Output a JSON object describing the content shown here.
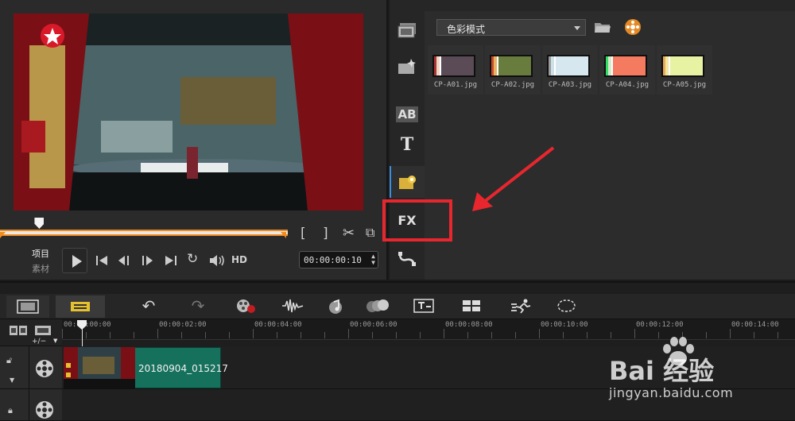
{
  "library": {
    "category_select": "色彩模式",
    "thumbnails": [
      {
        "name": "CP-A01.jpg",
        "colors": [
          "#a33",
          "#f1d6c4",
          "#fff",
          "#5b4b56"
        ]
      },
      {
        "name": "CP-A02.jpg",
        "colors": [
          "#c94a2a",
          "#e8b463",
          "#fff",
          "#687c3e"
        ]
      },
      {
        "name": "CP-A03.jpg",
        "colors": [
          "#9b9b9b",
          "#cfe1e8",
          "#fff",
          "#d7e7ef"
        ]
      },
      {
        "name": "CP-A04.jpg",
        "colors": [
          "#3d6",
          "#d4eac8",
          "#fff",
          "#f47a60"
        ]
      },
      {
        "name": "CP-A05.jpg",
        "colors": [
          "#e6ac57",
          "#f3e7a0",
          "#fff",
          "#e7f2a3"
        ]
      }
    ]
  },
  "preview": {
    "project_label": "项目",
    "clip_label": "素材",
    "hd_label": "HD",
    "timecode": "00:00:00:10",
    "scrub_fraction": 0.12
  },
  "side_tools": {
    "title_tool": "AB",
    "text_tool": "T",
    "fx_tool": "FX"
  },
  "timeline": {
    "ruler_labels": [
      "00:00:00:00",
      "00:00:02:00",
      "00:00:04:00",
      "00:00:06:00",
      "00:00:08:00",
      "00:00:10:00",
      "00:00:12:00",
      "00:00:14:00"
    ],
    "clip_name": "20180904_015217",
    "add_remove_label": "+/−"
  },
  "watermark": {
    "brand": "Bai 经验",
    "url": "jingyan.baidu.com"
  },
  "colors": {
    "accent_orange": "#f08b1e",
    "annotation_red": "#e8262e",
    "clip_green": "#15705c"
  }
}
